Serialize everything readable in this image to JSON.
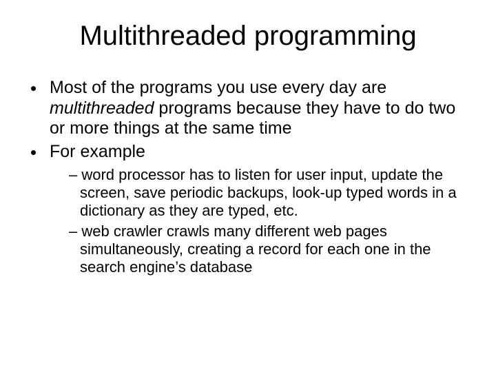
{
  "title": "Multithreaded programming",
  "bullets": {
    "b1_pre": "Most of the programs you use every day are ",
    "b1_italic": "multithreaded",
    "b1_post": " programs because they have to do two or more things at the same time",
    "b2": "For example",
    "sub1": "word processor has to listen for user input, update the screen, save periodic backups, look-up typed words in a dictionary as they are typed, etc.",
    "sub2": "web crawler crawls many different web pages simultaneously, creating a record for each one in the search engine’s database"
  }
}
